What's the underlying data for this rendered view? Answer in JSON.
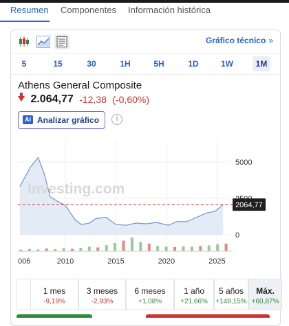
{
  "tabs": [
    "Resumen",
    "Componentes",
    "Información histórica"
  ],
  "toolbar": {
    "chart_types": [
      "candlestick-chart-icon",
      "area-chart-icon",
      "table-view-icon"
    ],
    "tech_chart_label": "Gráfico técnico",
    "tech_chart_arrow": "»"
  },
  "ranges": [
    "5",
    "15",
    "30",
    "1H",
    "5H",
    "1D",
    "1W",
    "1M"
  ],
  "selected_range": "1M",
  "instrument": {
    "name": "Athens General Composite",
    "price": "2.064,77",
    "change": "-12,38",
    "change_pct": "(-0,60%)"
  },
  "analyze_button": {
    "badge": "AI",
    "label": "Analizar gráfico"
  },
  "info_icon": "i",
  "chart_data": {
    "type": "area",
    "x_tick_labels": [
      "006",
      "2010",
      "2015",
      "2020",
      "2025"
    ],
    "y_tick_labels": [
      "5000",
      "2500",
      "0"
    ],
    "ylim": [
      0,
      6500
    ],
    "current_value_label": "2064,77",
    "current_value": 2064.77,
    "watermark": "Investing.com",
    "x": [
      2005.5,
      2006.5,
      2007.3,
      2007.9,
      2008.5,
      2009.2,
      2010.0,
      2010.5,
      2011.0,
      2011.6,
      2012.4,
      2013.0,
      2014.0,
      2015.0,
      2016.0,
      2017.0,
      2018.0,
      2019.0,
      2020.2,
      2021.0,
      2022.0,
      2023.0,
      2024.0,
      2024.8,
      2025.6
    ],
    "values": [
      3300,
      4600,
      5300,
      4200,
      2600,
      2300,
      2000,
      1500,
      1000,
      700,
      800,
      1100,
      1200,
      700,
      650,
      800,
      750,
      850,
      650,
      900,
      900,
      1200,
      1500,
      1600,
      2064.77
    ],
    "volume_levels": [
      0.1,
      0.15,
      0.12,
      0.18,
      0.14,
      0.2,
      0.16,
      0.22,
      0.3,
      0.25,
      0.4,
      0.55,
      0.7,
      0.9,
      0.6,
      0.5,
      0.35,
      0.3,
      0.28,
      0.32,
      0.3,
      0.34,
      0.38,
      0.45,
      0.5
    ],
    "grid": true
  },
  "performance": [
    {
      "label": "1 mes",
      "value": "-9,19%",
      "sign": "neg"
    },
    {
      "label": "3 meses",
      "value": "-2,93%",
      "sign": "neg"
    },
    {
      "label": "6 meses",
      "value": "+1,08%",
      "sign": "pos"
    },
    {
      "label": "1 año",
      "value": "+21,66%",
      "sign": "pos"
    },
    {
      "label": "5 años",
      "value": "+148,15%",
      "sign": "pos"
    },
    {
      "label": "Máx.",
      "value": "+60,87%",
      "sign": "pos"
    }
  ],
  "colors": {
    "accent": "#2a62c9",
    "negative": "#d0312d",
    "positive": "#2f8a3a",
    "series_line": "#6f94c7",
    "series_fill": "#dde7f4"
  }
}
